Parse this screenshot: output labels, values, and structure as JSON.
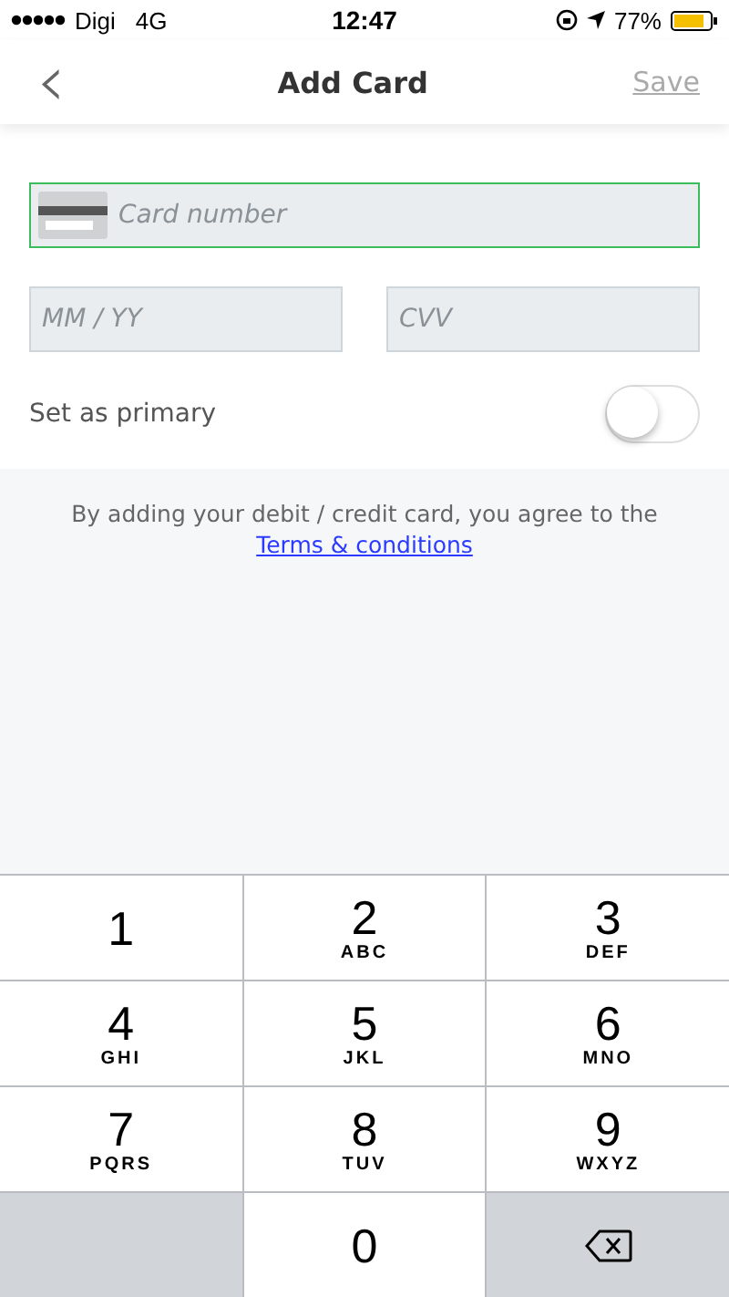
{
  "status_bar": {
    "carrier": "Digi",
    "network": "4G",
    "time": "12:47",
    "battery": "77%"
  },
  "nav": {
    "back": "‹",
    "title": "Add Card",
    "action": "Save"
  },
  "fields": [
    {
      "placeholder": "Card number",
      "focused": true
    },
    {
      "placeholder": "MM / YY",
      "focused": false
    },
    {
      "placeholder": "CVV",
      "focused": false
    }
  ],
  "primary": {
    "label": "Set as primary",
    "on": false
  },
  "terms": {
    "text": "By adding your debit / credit card, you agree to the",
    "link": "Terms & conditions"
  },
  "keyboard": [
    {
      "kind": "digit",
      "digit": "1"
    },
    {
      "kind": "digit",
      "digit": "2",
      "letters": "ABC"
    },
    {
      "kind": "digit",
      "digit": "3",
      "letters": "DEF"
    },
    {
      "kind": "digit",
      "digit": "4",
      "letters": "GHI"
    },
    {
      "kind": "digit",
      "digit": "5",
      "letters": "JKL"
    },
    {
      "kind": "digit",
      "digit": "6",
      "letters": "MNO"
    },
    {
      "kind": "digit",
      "digit": "7",
      "letters": "PQRS"
    },
    {
      "kind": "digit",
      "digit": "8",
      "letters": "TUV"
    },
    {
      "kind": "digit",
      "digit": "9",
      "letters": "WXYZ"
    },
    {
      "kind": "blank"
    },
    {
      "kind": "digit",
      "digit": "0"
    },
    {
      "kind": "delete"
    }
  ]
}
